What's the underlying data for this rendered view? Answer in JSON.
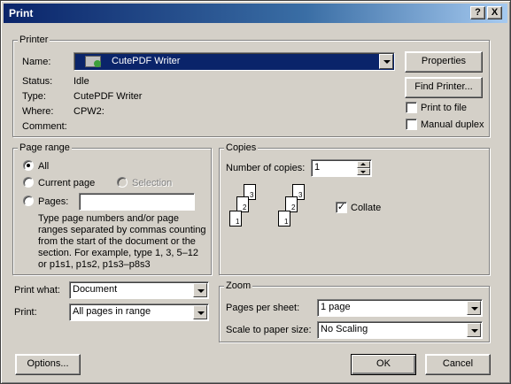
{
  "window": {
    "title": "Print",
    "help_button": "?",
    "close_button": "X"
  },
  "printer": {
    "group_label": "Printer",
    "name_label": "Name:",
    "name_value": "CutePDF Writer",
    "status_label": "Status:",
    "status_value": "Idle",
    "type_label": "Type:",
    "type_value": "CutePDF Writer",
    "where_label": "Where:",
    "where_value": "CPW2:",
    "comment_label": "Comment:",
    "comment_value": "",
    "properties_button": "Properties",
    "find_printer_button": "Find Printer...",
    "print_to_file_label": "Print to file",
    "print_to_file_checked": false,
    "manual_duplex_label": "Manual duplex",
    "manual_duplex_checked": false
  },
  "page_range": {
    "group_label": "Page range",
    "all_label": "All",
    "current_page_label": "Current page",
    "selection_label": "Selection",
    "pages_label": "Pages:",
    "pages_value": "",
    "selected": "All",
    "help_text": "Type page numbers and/or page ranges separated by commas counting from the start of the document or the section. For example, type 1, 3, 5–12 or p1s1, p1s2, p1s3–p8s3"
  },
  "copies": {
    "group_label": "Copies",
    "number_label": "Number of copies:",
    "number_value": "1",
    "collate_label": "Collate",
    "collate_checked": true,
    "collate_pages": [
      "1",
      "2",
      "3"
    ]
  },
  "print_what": {
    "label": "Print what:",
    "value": "Document"
  },
  "print": {
    "label": "Print:",
    "value": "All pages in range"
  },
  "zoom": {
    "group_label": "Zoom",
    "pages_per_sheet_label": "Pages per sheet:",
    "pages_per_sheet_value": "1 page",
    "scale_label": "Scale to paper size:",
    "scale_value": "No Scaling"
  },
  "footer": {
    "options_button": "Options...",
    "ok_button": "OK",
    "cancel_button": "Cancel"
  }
}
